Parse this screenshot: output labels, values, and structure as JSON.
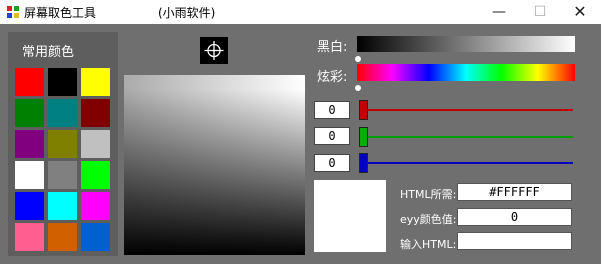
{
  "window": {
    "title": "屏幕取色工具",
    "subtitle": "(小雨软件)",
    "minimize": "—",
    "maximize": "☐",
    "close": "✕"
  },
  "palette": {
    "title": "常用颜色",
    "swatches": [
      "#ff0000",
      "#000000",
      "#ffff00",
      "#008000",
      "#008080",
      "#800000",
      "#800080",
      "#808000",
      "#c0c0c0",
      "#ffffff",
      "#808080",
      "#00ff00",
      "#0000ff",
      "#00ffff",
      "#ff00ff",
      "#ff6090",
      "#d06000",
      "#0060d0"
    ]
  },
  "bw": {
    "label": "黑白:"
  },
  "hue": {
    "label": "炫彩:"
  },
  "rgb": {
    "r": "0",
    "g": "0",
    "b": "0"
  },
  "colors": {
    "red": "#c00000",
    "green": "#00a000",
    "blue": "#0000c0"
  },
  "html_field": {
    "label": "HTML所需:",
    "value": "#FFFFFF"
  },
  "eyy_field": {
    "label": "eyy颜色值:",
    "value": "0"
  },
  "input_field": {
    "label": "输入HTML:",
    "value": ""
  }
}
